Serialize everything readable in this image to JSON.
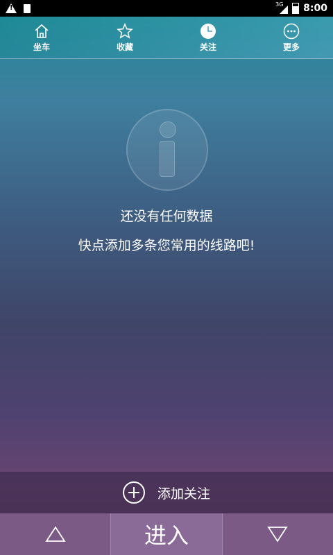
{
  "status": {
    "network": "3G",
    "time": "8:00"
  },
  "nav": {
    "tabs": [
      {
        "label": "坐车",
        "icon": "home-icon"
      },
      {
        "label": "收藏",
        "icon": "star-icon"
      },
      {
        "label": "关注",
        "icon": "clock-icon"
      },
      {
        "label": "更多",
        "icon": "more-icon"
      }
    ]
  },
  "empty": {
    "icon": "info-icon",
    "line1": "还没有任何数据",
    "line2": "快点添加多条您常用的线路吧!"
  },
  "add_follow": {
    "label": "添加关注",
    "icon": "plus-circle-icon"
  },
  "bottom": {
    "up_icon": "triangle-up-icon",
    "enter_label": "进入",
    "down_icon": "triangle-down-icon"
  }
}
